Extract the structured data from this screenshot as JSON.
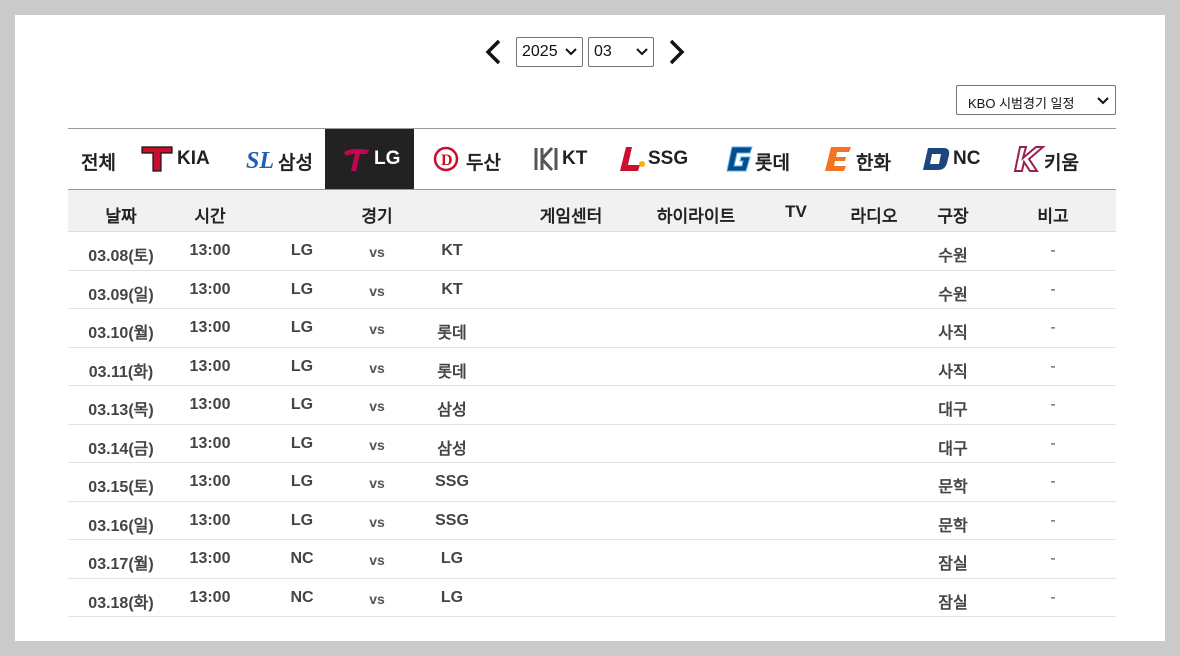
{
  "nav": {
    "prev_label": "‹",
    "next_label": "›",
    "year": "2025",
    "month": "03",
    "schedule_type": "KBO 시범경기 일정"
  },
  "teams": [
    {
      "key": "all",
      "label": "전체",
      "active": false
    },
    {
      "key": "kia",
      "label": "KIA",
      "color": "#c8102e",
      "active": false
    },
    {
      "key": "samsung",
      "label": "삼성",
      "color": "#1e5fb3",
      "active": false
    },
    {
      "key": "lg",
      "label": "LG",
      "color": "#c30452",
      "active": true
    },
    {
      "key": "doosan",
      "label": "두산",
      "color": "#c8102e",
      "active": false
    },
    {
      "key": "kt",
      "label": "KT",
      "color": "#555555",
      "active": false
    },
    {
      "key": "ssg",
      "label": "SSG",
      "color": "#ce0e2d",
      "active": false
    },
    {
      "key": "lotte",
      "label": "롯데",
      "color": "#0a4a8c",
      "active": false
    },
    {
      "key": "hanwha",
      "label": "한화",
      "color": "#f37321",
      "active": false
    },
    {
      "key": "nc",
      "label": "NC",
      "color": "#1d467f",
      "active": false
    },
    {
      "key": "kiwoom",
      "label": "키움",
      "color": "#9b1f4f",
      "active": false
    }
  ],
  "table": {
    "headers": {
      "date": "날짜",
      "time": "시간",
      "game": "경기",
      "game_center": "게임센터",
      "highlight": "하이라이트",
      "tv": "TV",
      "radio": "라디오",
      "stadium": "구장",
      "note": "비고"
    },
    "rows": [
      {
        "date": "03.08(토)",
        "time": "13:00",
        "away": "LG",
        "vs": "vs",
        "home": "KT",
        "stadium": "수원",
        "note": "-"
      },
      {
        "date": "03.09(일)",
        "time": "13:00",
        "away": "LG",
        "vs": "vs",
        "home": "KT",
        "stadium": "수원",
        "note": "-"
      },
      {
        "date": "03.10(월)",
        "time": "13:00",
        "away": "LG",
        "vs": "vs",
        "home": "롯데",
        "stadium": "사직",
        "note": "-"
      },
      {
        "date": "03.11(화)",
        "time": "13:00",
        "away": "LG",
        "vs": "vs",
        "home": "롯데",
        "stadium": "사직",
        "note": "-"
      },
      {
        "date": "03.13(목)",
        "time": "13:00",
        "away": "LG",
        "vs": "vs",
        "home": "삼성",
        "stadium": "대구",
        "note": "-"
      },
      {
        "date": "03.14(금)",
        "time": "13:00",
        "away": "LG",
        "vs": "vs",
        "home": "삼성",
        "stadium": "대구",
        "note": "-"
      },
      {
        "date": "03.15(토)",
        "time": "13:00",
        "away": "LG",
        "vs": "vs",
        "home": "SSG",
        "stadium": "문학",
        "note": "-"
      },
      {
        "date": "03.16(일)",
        "time": "13:00",
        "away": "LG",
        "vs": "vs",
        "home": "SSG",
        "stadium": "문학",
        "note": "-"
      },
      {
        "date": "03.17(월)",
        "time": "13:00",
        "away": "NC",
        "vs": "vs",
        "home": "LG",
        "stadium": "잠실",
        "note": "-"
      },
      {
        "date": "03.18(화)",
        "time": "13:00",
        "away": "NC",
        "vs": "vs",
        "home": "LG",
        "stadium": "잠실",
        "note": "-"
      }
    ]
  }
}
